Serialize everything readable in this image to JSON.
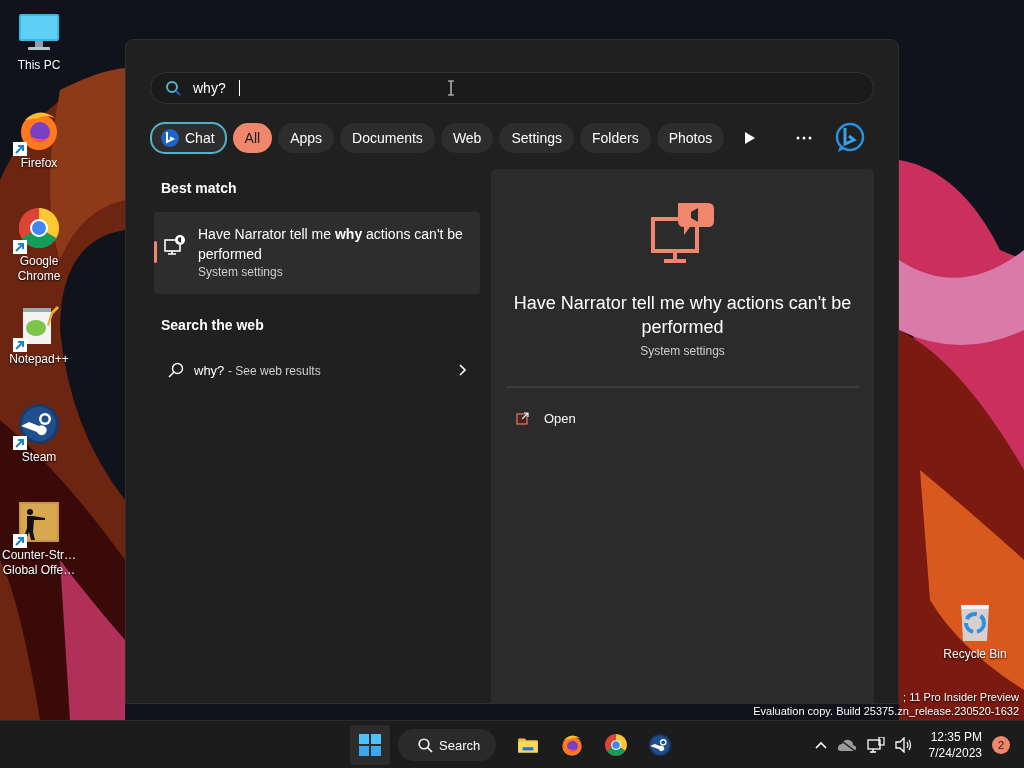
{
  "desktop_icons": [
    {
      "kind": "pc",
      "label": "This PC",
      "shortcut": false
    },
    {
      "kind": "firefox",
      "label": "Firefox",
      "shortcut": true
    },
    {
      "kind": "chrome",
      "label": "Google Chrome",
      "shortcut": true
    },
    {
      "kind": "notepad",
      "label": "Notepad++",
      "shortcut": true
    },
    {
      "kind": "steam",
      "label": "Steam",
      "shortcut": true
    },
    {
      "kind": "game",
      "label": "Counter-Str… Global Offe…",
      "shortcut": true
    },
    {
      "kind": "bin",
      "label": "Recycle Bin",
      "shortcut": false
    }
  ],
  "watermark": [
    "; 11 Pro Insider Preview",
    "Evaluation copy. Build 25375.zn_release.230520-1632"
  ],
  "search_panel": {
    "query": "why?",
    "filters": [
      {
        "kind": "chat",
        "label": "Chat",
        "selected": false
      },
      {
        "kind": "filter",
        "label": "All",
        "selected": true
      },
      {
        "kind": "filter",
        "label": "Apps",
        "selected": false
      },
      {
        "kind": "filter",
        "label": "Documents",
        "selected": false
      },
      {
        "kind": "filter",
        "label": "Web",
        "selected": false
      },
      {
        "kind": "filter",
        "label": "Settings",
        "selected": false
      },
      {
        "kind": "filter",
        "label": "Folders",
        "selected": false
      },
      {
        "kind": "filter",
        "label": "Photos",
        "selected": false
      }
    ],
    "best_match": {
      "heading": "Best match",
      "title": "Have Narrator tell me **why** actions can't be performed",
      "subtitle": "System settings",
      "selected": true
    },
    "web": {
      "heading": "Search the web",
      "query": "why?",
      "suffix": "- See web results"
    },
    "preview": {
      "title": "Have Narrator tell me why actions can't be performed",
      "subtitle": "System settings",
      "actions": [
        {
          "label": "Open"
        }
      ]
    }
  },
  "taskbar": {
    "search_label": "Search",
    "apps": [
      {
        "kind": "explorer"
      },
      {
        "kind": "firefox"
      },
      {
        "kind": "chrome"
      },
      {
        "kind": "steam"
      }
    ],
    "clock": {
      "time": "12:35 PM",
      "date": "7/24/2023"
    },
    "notifications": "2"
  }
}
